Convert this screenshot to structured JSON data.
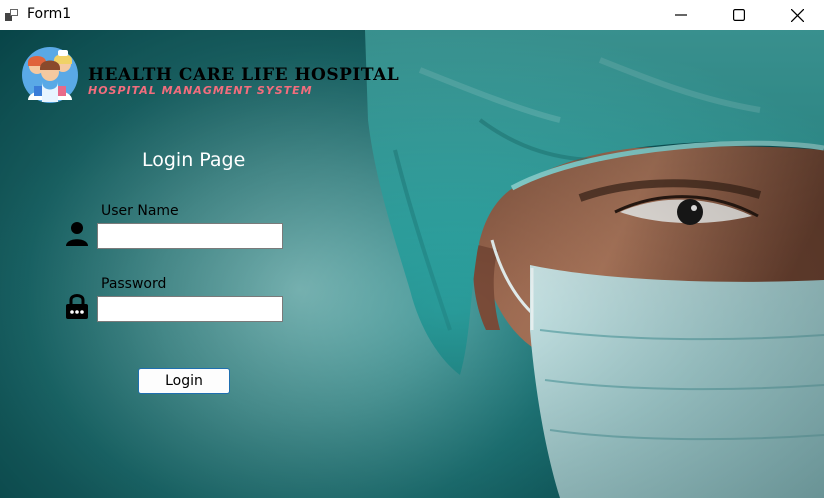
{
  "window": {
    "title": "Form1",
    "icon": "winforms-app-icon",
    "controls": [
      "minimize-icon",
      "maximize-icon",
      "close-icon"
    ]
  },
  "branding": {
    "hospital_name": "HEALTH CARE LIFE HOSPITAL",
    "subtitle": "HOSPITAL MANAGMENT SYSTEM",
    "logo": "doctors-logo",
    "subtitle_color": "#f26d7d"
  },
  "login": {
    "title": "Login Page",
    "username_label": "User Name",
    "username_value": "",
    "username_icon": "user-icon",
    "password_label": "Password",
    "password_value": "",
    "password_icon": "lock-icon",
    "button_label": "Login"
  },
  "colors": {
    "background_teal": "#1f7b7d",
    "scrub_cap": "#5fc9c6",
    "button_border": "#1f6fb0"
  }
}
